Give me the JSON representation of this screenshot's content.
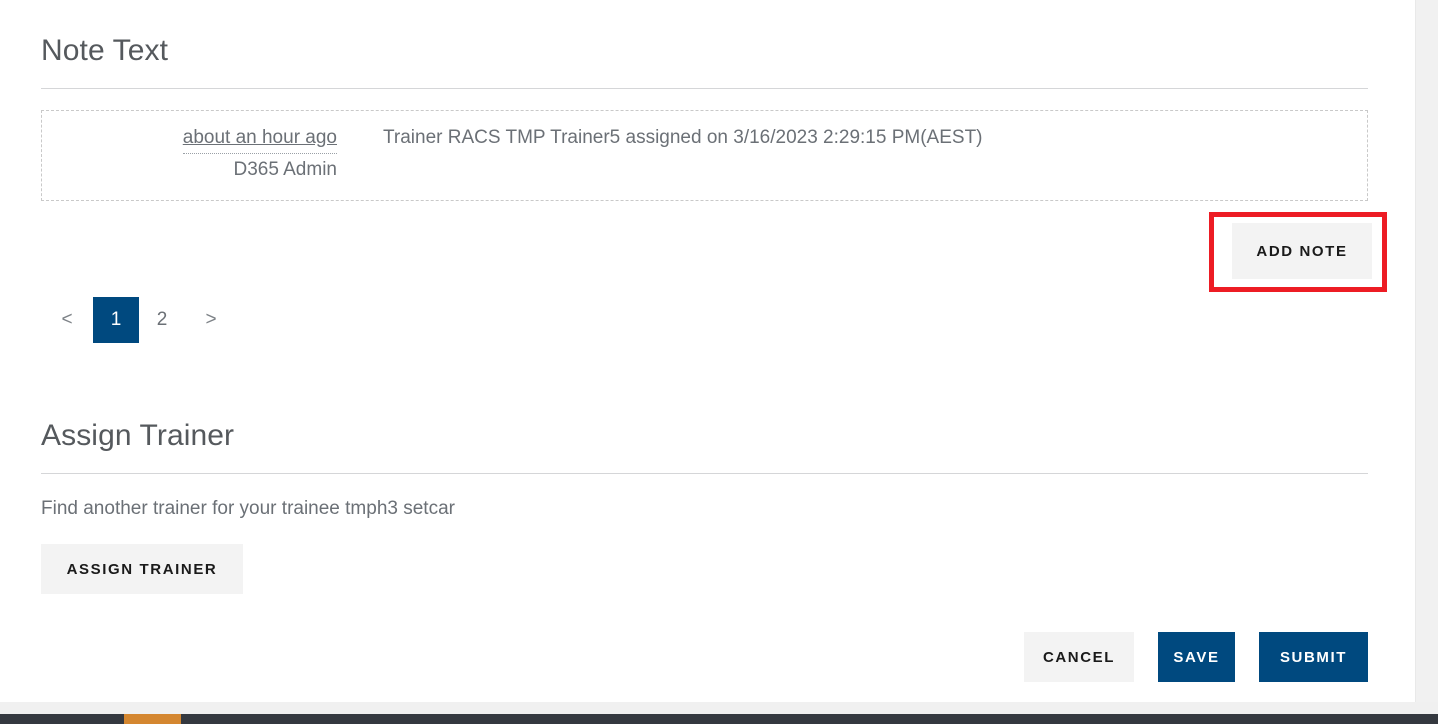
{
  "note_section": {
    "heading": "Note Text",
    "notes": [
      {
        "time": "about an hour ago",
        "author": "D365 Admin",
        "body": "Trainer RACS TMP Trainer5 assigned on 3/16/2023 2:29:15 PM(AEST)"
      }
    ],
    "add_note_label": "ADD NOTE",
    "highlight_color": "#ed1c24"
  },
  "pagination": {
    "prev_label": "<",
    "next_label": ">",
    "pages": [
      "1",
      "2"
    ],
    "active_page": "1",
    "active_color": "#00497f"
  },
  "assign_section": {
    "heading": "Assign Trainer",
    "description": "Find another trainer for your trainee tmph3 setcar",
    "assign_button_label": "ASSIGN TRAINER"
  },
  "footer_actions": {
    "cancel_label": "CANCEL",
    "save_label": "SAVE",
    "submit_label": "SUBMIT"
  },
  "chrome": {
    "taskbar_color": "#34383f",
    "taskbar_active_item_color": "#d4862f",
    "gutter_color": "#f1f1f1"
  }
}
